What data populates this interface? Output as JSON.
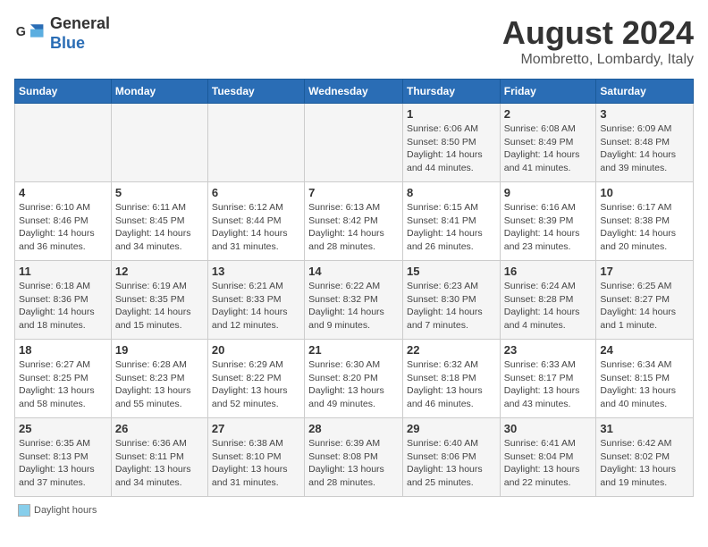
{
  "header": {
    "logo_line1": "General",
    "logo_line2": "Blue",
    "month_title": "August 2024",
    "location": "Mombretto, Lombardy, Italy"
  },
  "days_of_week": [
    "Sunday",
    "Monday",
    "Tuesday",
    "Wednesday",
    "Thursday",
    "Friday",
    "Saturday"
  ],
  "weeks": [
    [
      {
        "day": "",
        "info": ""
      },
      {
        "day": "",
        "info": ""
      },
      {
        "day": "",
        "info": ""
      },
      {
        "day": "",
        "info": ""
      },
      {
        "day": "1",
        "info": "Sunrise: 6:06 AM\nSunset: 8:50 PM\nDaylight: 14 hours\nand 44 minutes."
      },
      {
        "day": "2",
        "info": "Sunrise: 6:08 AM\nSunset: 8:49 PM\nDaylight: 14 hours\nand 41 minutes."
      },
      {
        "day": "3",
        "info": "Sunrise: 6:09 AM\nSunset: 8:48 PM\nDaylight: 14 hours\nand 39 minutes."
      }
    ],
    [
      {
        "day": "4",
        "info": "Sunrise: 6:10 AM\nSunset: 8:46 PM\nDaylight: 14 hours\nand 36 minutes."
      },
      {
        "day": "5",
        "info": "Sunrise: 6:11 AM\nSunset: 8:45 PM\nDaylight: 14 hours\nand 34 minutes."
      },
      {
        "day": "6",
        "info": "Sunrise: 6:12 AM\nSunset: 8:44 PM\nDaylight: 14 hours\nand 31 minutes."
      },
      {
        "day": "7",
        "info": "Sunrise: 6:13 AM\nSunset: 8:42 PM\nDaylight: 14 hours\nand 28 minutes."
      },
      {
        "day": "8",
        "info": "Sunrise: 6:15 AM\nSunset: 8:41 PM\nDaylight: 14 hours\nand 26 minutes."
      },
      {
        "day": "9",
        "info": "Sunrise: 6:16 AM\nSunset: 8:39 PM\nDaylight: 14 hours\nand 23 minutes."
      },
      {
        "day": "10",
        "info": "Sunrise: 6:17 AM\nSunset: 8:38 PM\nDaylight: 14 hours\nand 20 minutes."
      }
    ],
    [
      {
        "day": "11",
        "info": "Sunrise: 6:18 AM\nSunset: 8:36 PM\nDaylight: 14 hours\nand 18 minutes."
      },
      {
        "day": "12",
        "info": "Sunrise: 6:19 AM\nSunset: 8:35 PM\nDaylight: 14 hours\nand 15 minutes."
      },
      {
        "day": "13",
        "info": "Sunrise: 6:21 AM\nSunset: 8:33 PM\nDaylight: 14 hours\nand 12 minutes."
      },
      {
        "day": "14",
        "info": "Sunrise: 6:22 AM\nSunset: 8:32 PM\nDaylight: 14 hours\nand 9 minutes."
      },
      {
        "day": "15",
        "info": "Sunrise: 6:23 AM\nSunset: 8:30 PM\nDaylight: 14 hours\nand 7 minutes."
      },
      {
        "day": "16",
        "info": "Sunrise: 6:24 AM\nSunset: 8:28 PM\nDaylight: 14 hours\nand 4 minutes."
      },
      {
        "day": "17",
        "info": "Sunrise: 6:25 AM\nSunset: 8:27 PM\nDaylight: 14 hours\nand 1 minute."
      }
    ],
    [
      {
        "day": "18",
        "info": "Sunrise: 6:27 AM\nSunset: 8:25 PM\nDaylight: 13 hours\nand 58 minutes."
      },
      {
        "day": "19",
        "info": "Sunrise: 6:28 AM\nSunset: 8:23 PM\nDaylight: 13 hours\nand 55 minutes."
      },
      {
        "day": "20",
        "info": "Sunrise: 6:29 AM\nSunset: 8:22 PM\nDaylight: 13 hours\nand 52 minutes."
      },
      {
        "day": "21",
        "info": "Sunrise: 6:30 AM\nSunset: 8:20 PM\nDaylight: 13 hours\nand 49 minutes."
      },
      {
        "day": "22",
        "info": "Sunrise: 6:32 AM\nSunset: 8:18 PM\nDaylight: 13 hours\nand 46 minutes."
      },
      {
        "day": "23",
        "info": "Sunrise: 6:33 AM\nSunset: 8:17 PM\nDaylight: 13 hours\nand 43 minutes."
      },
      {
        "day": "24",
        "info": "Sunrise: 6:34 AM\nSunset: 8:15 PM\nDaylight: 13 hours\nand 40 minutes."
      }
    ],
    [
      {
        "day": "25",
        "info": "Sunrise: 6:35 AM\nSunset: 8:13 PM\nDaylight: 13 hours\nand 37 minutes."
      },
      {
        "day": "26",
        "info": "Sunrise: 6:36 AM\nSunset: 8:11 PM\nDaylight: 13 hours\nand 34 minutes."
      },
      {
        "day": "27",
        "info": "Sunrise: 6:38 AM\nSunset: 8:10 PM\nDaylight: 13 hours\nand 31 minutes."
      },
      {
        "day": "28",
        "info": "Sunrise: 6:39 AM\nSunset: 8:08 PM\nDaylight: 13 hours\nand 28 minutes."
      },
      {
        "day": "29",
        "info": "Sunrise: 6:40 AM\nSunset: 8:06 PM\nDaylight: 13 hours\nand 25 minutes."
      },
      {
        "day": "30",
        "info": "Sunrise: 6:41 AM\nSunset: 8:04 PM\nDaylight: 13 hours\nand 22 minutes."
      },
      {
        "day": "31",
        "info": "Sunrise: 6:42 AM\nSunset: 8:02 PM\nDaylight: 13 hours\nand 19 minutes."
      }
    ]
  ],
  "legend": {
    "items": [
      {
        "label": "Daylight hours",
        "color": "#87ceeb"
      }
    ]
  }
}
